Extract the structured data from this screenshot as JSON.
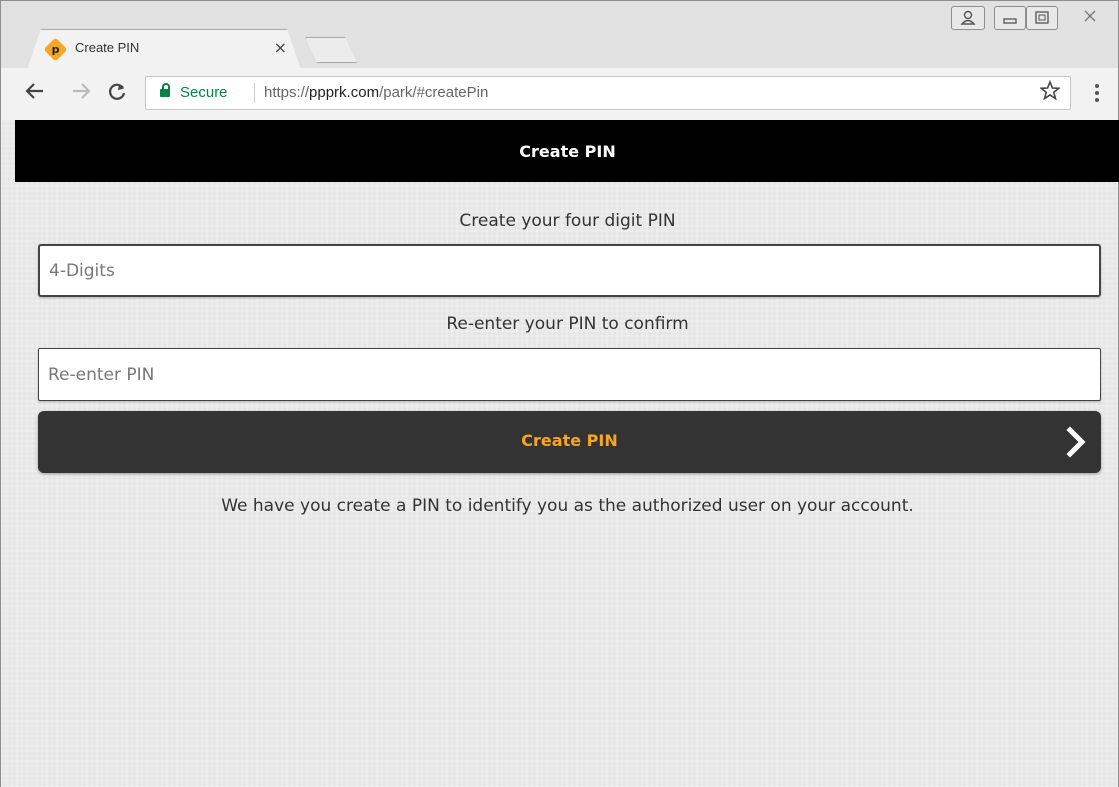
{
  "browser": {
    "tab": {
      "title": "Create PIN",
      "close_glyph": "×",
      "favicon_letter": "p"
    },
    "address_bar": {
      "secure_label": "Secure",
      "url_scheme": "https://",
      "url_host": "ppprk.com",
      "url_path": "/park/#createPin"
    }
  },
  "page": {
    "header_title": "Create PIN",
    "pin_prompt": "Create your four digit PIN",
    "pin_placeholder": "4-Digits",
    "confirm_prompt": "Re-enter your PIN to confirm",
    "confirm_placeholder": "Re-enter PIN",
    "submit_label": "Create PIN",
    "explanation": "We have you create a PIN to identify you as the authorized user on your account."
  },
  "colors": {
    "header_bg": "#000000",
    "button_bg": "#333333",
    "button_text": "#f6a623",
    "secure_green": "#0b8043",
    "favicon": "#f5a623"
  },
  "icons": [
    "favicon-icon",
    "close-icon",
    "new-tab-icon",
    "user-icon",
    "minimize-icon",
    "maximize-icon",
    "window-close-icon",
    "back-icon",
    "forward-icon",
    "reload-icon",
    "lock-icon",
    "star-icon",
    "menu-icon",
    "chevron-right-icon"
  ]
}
